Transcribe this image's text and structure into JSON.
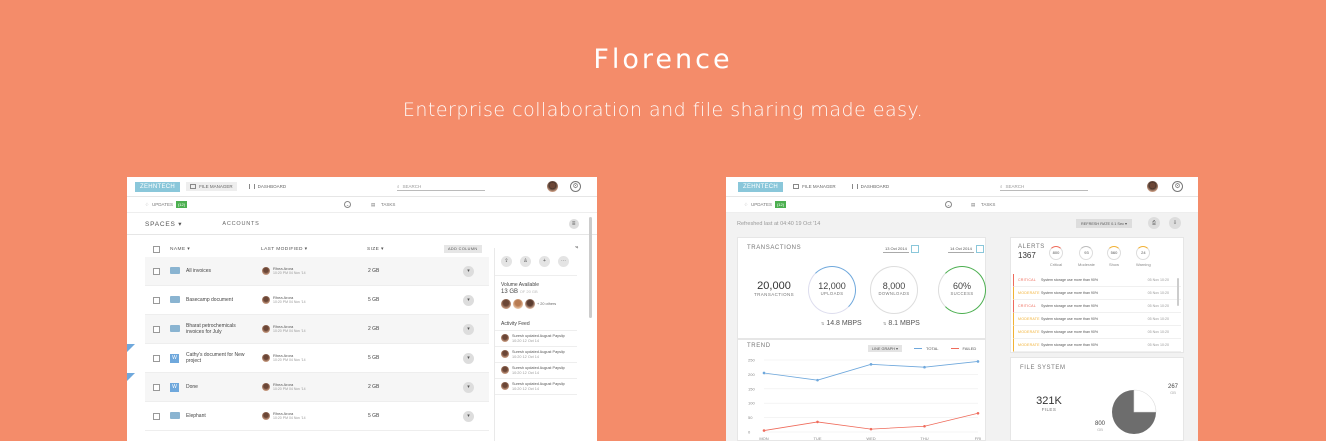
{
  "hero": {
    "title": "Florence",
    "subtitle": "Enterprise collaboration and file sharing made easy."
  },
  "app_topbar": {
    "logo": "ZEHNTECH",
    "tabs": [
      {
        "label": "FILE MANAGER",
        "icon": "home-icon"
      },
      {
        "label": "DASHBOARD",
        "icon": "bar-chart-icon"
      }
    ],
    "search_placeholder": "SEARCH"
  },
  "file_manager": {
    "subbar": {
      "updates_label": "UPDATES",
      "updates_count": "(12)",
      "tasks_label": "TASKS"
    },
    "spaces_label": "SPACES ▾",
    "accounts_label": "ACCOUNTS",
    "columns": {
      "name": "NAME ▾",
      "modified": "LAST MODIFIED ▾",
      "size": "SIZE ▾",
      "add_column": "ADD COLUMN"
    },
    "rows": [
      {
        "name": "All invoices",
        "type": "folder",
        "user": "Rhea Arora",
        "time": "10:20 PM 04 Nov '14",
        "size": "2 GB",
        "shared": false
      },
      {
        "name": "Basecamp document",
        "type": "folder",
        "user": "Rhea Arora",
        "time": "10:20 PM 04 Nov '14",
        "size": "5 GB",
        "shared": false
      },
      {
        "name": "Bharat petrochemicals invoices for July",
        "type": "folder",
        "user": "Rhea Arora",
        "time": "10:20 PM 04 Nov '14",
        "size": "2 GB",
        "shared": false
      },
      {
        "name": "Cathy's document for New project",
        "type": "word",
        "user": "Rhea Arora",
        "time": "10:20 PM 04 Nov '14",
        "size": "5 GB",
        "shared": true
      },
      {
        "name": "Done",
        "type": "word",
        "user": "Rhea Arora",
        "time": "10:20 PM 04 Nov '14",
        "size": "2 GB",
        "shared": true
      },
      {
        "name": "Elephant",
        "type": "folder",
        "user": "Rhea Arora",
        "time": "10:20 PM 04 Nov '14",
        "size": "5 GB",
        "shared": false
      }
    ],
    "side_panel": {
      "volume_title": "Volume Available",
      "volume_value": "13 GB",
      "volume_total": "OF 20 GB",
      "others": "+ 20 others",
      "activity_title": "Activity Feed",
      "feed": [
        {
          "text": "Suresh updated August Payslip",
          "time": "10:20 12 Oct 14"
        },
        {
          "text": "Suresh updated August Payslip",
          "time": "10:20 12 Oct 14"
        },
        {
          "text": "Suresh updated August Payslip",
          "time": "10:20 12 Oct 14"
        },
        {
          "text": "Suresh updated August Payslip",
          "time": "10:20 12 Oct 14"
        }
      ]
    }
  },
  "dashboard": {
    "refreshed": "Refreshed last at 04:40  19 Oct '14",
    "refresh_rate": "REFRESH RATE 0.1 Sec ▾",
    "transactions": {
      "title": "TRANSACTIONS",
      "date_from": "13 Oct 2014",
      "date_to": "14 Oct 2014",
      "total_value": "20,000",
      "total_label": "TRANSACTIONS",
      "uploads_value": "12,000",
      "uploads_label": "UPLOADS",
      "downloads_value": "8,000",
      "downloads_label": "DOWNLOADS",
      "success_value": "60%",
      "success_label": "SUCCESS",
      "upload_speed": "14.8 MBPS",
      "download_speed": "8.1 MBPS"
    },
    "trend": {
      "title": "TREND",
      "graph_select": "LINE GRAPH ▾",
      "legend_total": "TOTAL",
      "legend_failed": "FAILED"
    },
    "alerts": {
      "title": "ALERTS",
      "count": "1367",
      "severities": [
        {
          "label": "Critical",
          "value": "800"
        },
        {
          "label": "Moderate",
          "value": "93"
        },
        {
          "label": "Show",
          "value": "560"
        },
        {
          "label": "Warning",
          "value": "24"
        }
      ],
      "rows": [
        {
          "level": "CRITICAL",
          "msg": "System storage use more than 90%",
          "date": "05 Nov 10:20",
          "color": "#ef6b5b"
        },
        {
          "level": "MODERATE",
          "msg": "System storage use more than 90%",
          "date": "05 Nov 10:20",
          "color": "#f2b134"
        },
        {
          "level": "CRITICAL",
          "msg": "System storage use more than 90%",
          "date": "05 Nov 10:20",
          "color": "#ef6b5b"
        },
        {
          "level": "MODERATE",
          "msg": "System storage use more than 90%",
          "date": "05 Nov 10:20",
          "color": "#f2b134"
        },
        {
          "level": "MODERATE",
          "msg": "System storage use more than 90%",
          "date": "05 Nov 10:20",
          "color": "#f2b134"
        },
        {
          "level": "MODERATE",
          "msg": "System storage use more than 90%",
          "date": "05 Nov 10:20",
          "color": "#f2b134"
        }
      ]
    },
    "file_system": {
      "title": "FILE SYSTEM",
      "files_value": "321K",
      "files_label": "FILES",
      "slice_a_value": "267",
      "slice_a_unit": "GB",
      "slice_b_value": "800",
      "slice_b_unit": "GB"
    }
  },
  "chart_data": {
    "type": "line",
    "title": "TREND",
    "categories": [
      "MON",
      "TUE",
      "WED",
      "THU",
      "FRI"
    ],
    "yticks": [
      "250",
      "200",
      "150",
      "100",
      "50",
      "0"
    ],
    "ylim": [
      0,
      250
    ],
    "series": [
      {
        "name": "TOTAL",
        "values": [
          205,
          180,
          235,
          225,
          245
        ],
        "color": "#6fa8dc"
      },
      {
        "name": "FAILED",
        "values": [
          5,
          35,
          10,
          20,
          65
        ],
        "color": "#ef6b5b"
      }
    ],
    "legend": "top-right",
    "grid": true
  }
}
